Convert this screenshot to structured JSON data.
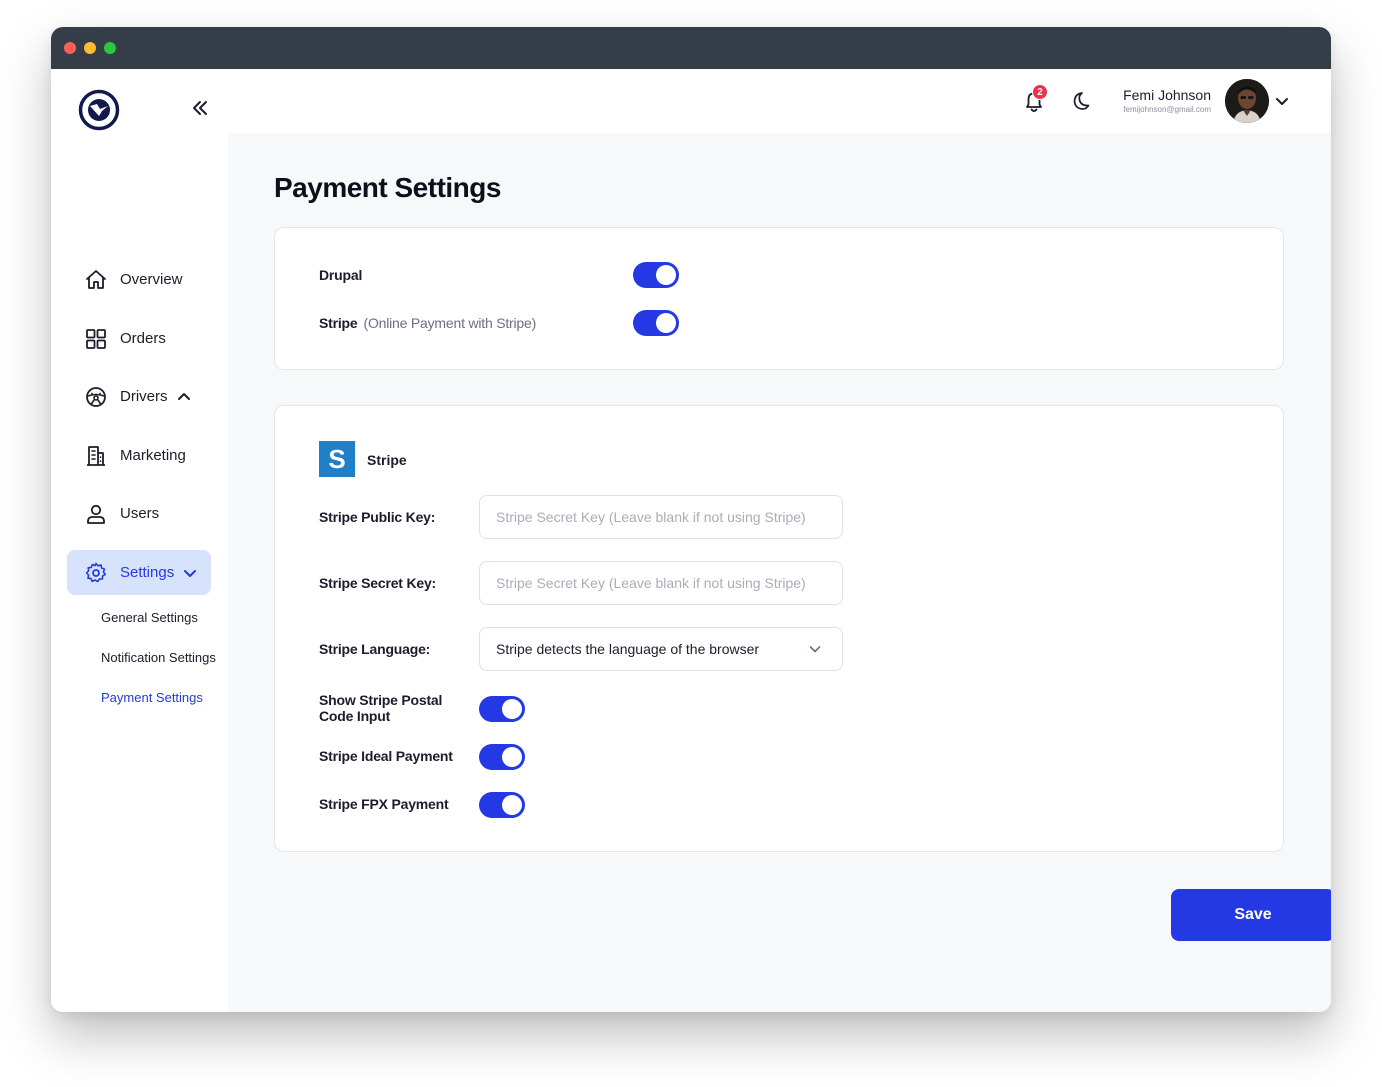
{
  "sidebar": {
    "items": [
      {
        "label": "Overview",
        "icon": "home-icon"
      },
      {
        "label": "Orders",
        "icon": "grid-icon"
      },
      {
        "label": "Drivers",
        "icon": "steering-wheel-icon"
      },
      {
        "label": "Marketing",
        "icon": "building-icon"
      },
      {
        "label": "Users",
        "icon": "user-icon"
      },
      {
        "label": "Settings",
        "icon": "gear-icon"
      }
    ],
    "sub_items": [
      {
        "label": "General Settings"
      },
      {
        "label": "Notification Settings"
      },
      {
        "label": "Payment Settings"
      }
    ]
  },
  "header": {
    "notification_count": "2",
    "user_name": "Femi Johnson",
    "user_email": "femijohnson@gmail.com"
  },
  "page": {
    "title": "Payment Settings"
  },
  "gateways": {
    "drupal_label": "Drupal",
    "drupal_enabled": true,
    "stripe_label": "Stripe",
    "stripe_hint": "(Online Payment with Stripe)",
    "stripe_enabled": true
  },
  "stripe": {
    "logo_letter": "S",
    "title": "Stripe",
    "public_key_label": "Stripe Public Key:",
    "public_key_placeholder": "Stripe Secret Key (Leave blank if not using Stripe)",
    "secret_key_label": "Stripe Secret Key:",
    "secret_key_placeholder": "Stripe Secret Key (Leave blank if not using Stripe)",
    "language_label": "Stripe Language:",
    "language_value": "Stripe detects the language of the browser",
    "postal_label": "Show Stripe Postal Code Input",
    "postal_enabled": true,
    "ideal_label": "Stripe Ideal Payment",
    "ideal_enabled": true,
    "fpx_label": "Stripe FPX Payment",
    "fpx_enabled": true
  },
  "actions": {
    "save_label": "Save"
  },
  "colors": {
    "accent": "#2438e4",
    "active_nav_bg": "#d7e3fc",
    "badge": "#e8344e",
    "stripe_brand": "#1f7fc8"
  }
}
